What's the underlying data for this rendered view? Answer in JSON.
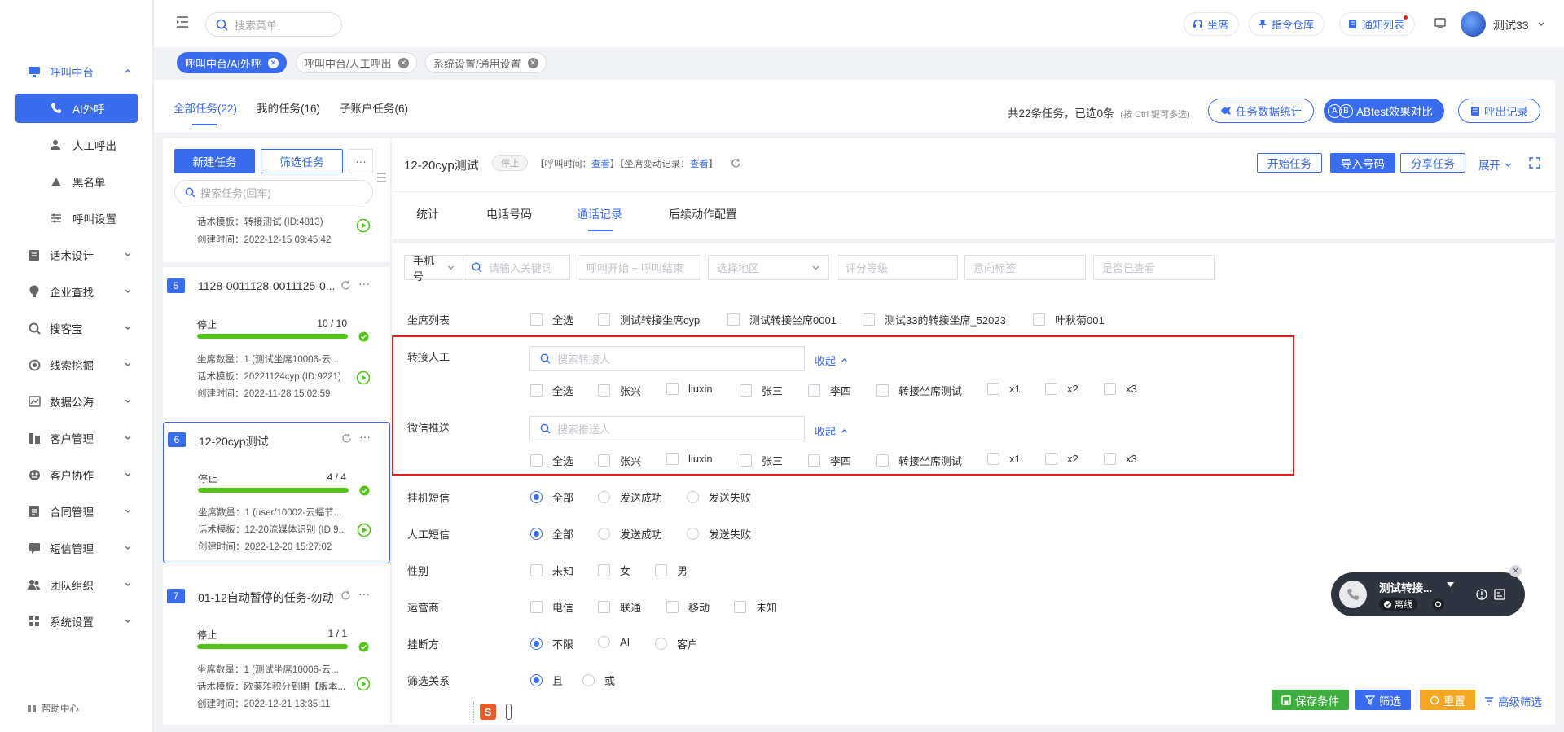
{
  "sidebar": {
    "items": [
      {
        "label": "呼叫中台",
        "icon": "phone-monitor-icon"
      },
      {
        "label": "话术设计",
        "icon": "script-icon"
      },
      {
        "label": "企业查找",
        "icon": "lightbulb-icon"
      },
      {
        "label": "搜客宝",
        "icon": "search-customer-icon"
      },
      {
        "label": "线索挖掘",
        "icon": "target-icon"
      },
      {
        "label": "数据公海",
        "icon": "data-chart-icon"
      },
      {
        "label": "客户管理",
        "icon": "customer-icon"
      },
      {
        "label": "客户协作",
        "icon": "cooperation-icon"
      },
      {
        "label": "合同管理",
        "icon": "contract-icon"
      },
      {
        "label": "短信管理",
        "icon": "sms-icon"
      },
      {
        "label": "团队组织",
        "icon": "team-icon"
      },
      {
        "label": "系统设置",
        "icon": "grid-settings-icon"
      }
    ],
    "subitems": [
      {
        "label": "AI外呼",
        "icon": "phone-icon",
        "active": true
      },
      {
        "label": "人工呼出",
        "icon": "person-icon"
      },
      {
        "label": "黑名单",
        "icon": "warning-icon"
      },
      {
        "label": "呼叫设置",
        "icon": "sliders-icon"
      }
    ],
    "help": "帮助中心"
  },
  "header": {
    "search_placeholder": "搜索菜单",
    "pills": [
      "坐席",
      "指令仓库",
      "通知列表"
    ],
    "username": "测试33"
  },
  "tabs": [
    {
      "label": "呼叫中台/AI外呼",
      "active": true
    },
    {
      "label": "呼叫中台/人工呼出"
    },
    {
      "label": "系统设置/通用设置"
    }
  ],
  "task_tabs": [
    "全部任务(22)",
    "我的任务(16)",
    "子账户任务(6)"
  ],
  "summary": "共22条任务，已选0条",
  "summary_hint": "(按 Ctrl 键可多选)",
  "top_buttons": {
    "stats": "任务数据统计",
    "ab": "ABtest效果对比",
    "records": "呼出记录"
  },
  "left": {
    "new_task": "新建任务",
    "filter_task": "筛选任务",
    "more": "···",
    "search_placeholder": "搜索任务(回车)",
    "partial_card": {
      "template": "话术模板：转接测试 (ID:4813)",
      "created": "创建时间：2022-12-15 09:45:42"
    },
    "cards": [
      {
        "num": "5",
        "title": "1128-0011128-0011125-0...",
        "status": "停止",
        "count": "10 / 10",
        "progress": 1.0,
        "seats": "坐席数量：1 (测试坐席10006-云...",
        "template": "话术模板：20221124cyp (ID:9221)",
        "created": "创建时间：2022-11-28 15:02:59"
      },
      {
        "num": "6",
        "title": "12-20cyp测试",
        "status": "停止",
        "count": "4 / 4",
        "progress": 1.0,
        "seats": "坐席数量：1 (user/10002-云蝠节...",
        "template": "话术模板：12-20流媒体识别 (ID:9...",
        "created": "创建时间：2022-12-20 15:27:02"
      },
      {
        "num": "7",
        "title": "01-12自动暂停的任务-勿动",
        "status": "停止",
        "count": "1 / 1",
        "progress": 1.0,
        "seats": "坐席数量：1 (测试坐席10006-云...",
        "template": "话术模板：欧莱雅积分到期【版本...",
        "created": "创建时间：2022-12-21 13:35:11"
      }
    ]
  },
  "detail": {
    "title": "12-20cyp测试",
    "status": "停止",
    "call_time_label": "【呼叫时间：",
    "view": "查看",
    "seat_change_label": "】【坐席变动记录：",
    "close_bracket": "】",
    "buttons": [
      "开始任务",
      "导入号码",
      "分享任务"
    ],
    "expand": "展开",
    "subtabs": [
      "统计",
      "电话号码",
      "通话记录",
      "后续动作配置"
    ],
    "filters": {
      "phone_select": "手机号",
      "keyword": "请输入关键词",
      "call_range": "呼叫开始 ~ 呼叫结束",
      "region": "选择地区",
      "score": "评分等级",
      "intent": "意向标签",
      "viewed": "是否已查看"
    },
    "rows": {
      "seat_list": {
        "label": "坐席列表",
        "options": [
          "全选",
          "测试转接坐席cyp",
          "测试转接坐席0001",
          "测试33的转接坐席_52023",
          "叶秋菊001"
        ]
      },
      "transfer": {
        "label": "转接人工",
        "search": "搜索转接人",
        "collapse": "收起",
        "options": [
          "全选",
          "张兴",
          "liuxin",
          "张三",
          "李四",
          "转接坐席测试",
          "x1",
          "x2",
          "x3"
        ]
      },
      "wechat": {
        "label": "微信推送",
        "search": "搜索推送人",
        "collapse": "收起",
        "options": [
          "全选",
          "张兴",
          "liuxin",
          "张三",
          "李四",
          "转接坐席测试",
          "x1",
          "x2",
          "x3"
        ]
      },
      "hangup_sms": {
        "label": "挂机短信",
        "options": [
          "全部",
          "发送成功",
          "发送失败"
        ]
      },
      "manual_sms": {
        "label": "人工短信",
        "options": [
          "全部",
          "发送成功",
          "发送失败"
        ]
      },
      "gender": {
        "label": "性别",
        "options": [
          "未知",
          "女",
          "男"
        ]
      },
      "carrier": {
        "label": "运营商",
        "options": [
          "电信",
          "联通",
          "移动",
          "未知"
        ]
      },
      "hangup_side": {
        "label": "挂断方",
        "options": [
          "不限",
          "AI",
          "客户"
        ]
      },
      "relation": {
        "label": "筛选关系",
        "options": [
          "且",
          "或"
        ]
      }
    },
    "bottom_buttons": {
      "save": "保存条件",
      "filter": "筛选",
      "reset": "重置",
      "advanced": "高级筛选"
    }
  },
  "call_widget": {
    "name": "测试转接...",
    "status": "离线"
  },
  "colors": {
    "primary": "#3a6cf0",
    "success": "#52c41a",
    "save": "#3fae3f",
    "reset": "#f5a623",
    "highlight": "#e02020"
  }
}
